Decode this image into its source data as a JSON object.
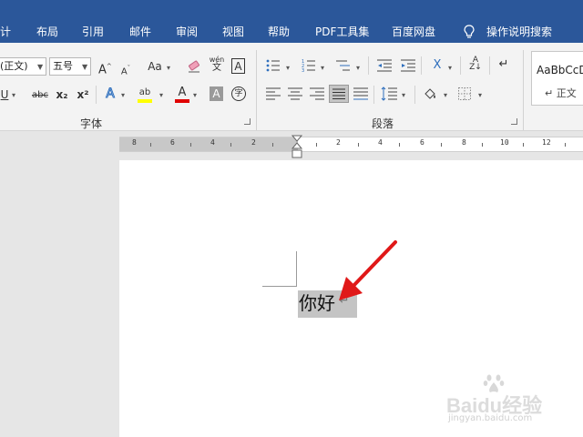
{
  "tabs": [
    "计",
    "布局",
    "引用",
    "邮件",
    "审阅",
    "视图",
    "帮助",
    "PDF工具集",
    "百度网盘",
    "操作说明搜索"
  ],
  "font": {
    "name_value": "(正文)",
    "size_value": "五号",
    "grow_label": "A",
    "shrink_label": "A",
    "case_label": "Aa",
    "phonetic_label": "wén",
    "phonetic_sub": "文",
    "border_char_label": "A",
    "underline_label": "U",
    "strike_label": "abc",
    "sub_label": "x₂",
    "sup_label": "x²",
    "effects_label": "A",
    "highlight_label": "ab",
    "color_label": "A",
    "shading_label": "A",
    "enclose_label": "字",
    "group_label": "字体"
  },
  "paragraph": {
    "group_label": "段落"
  },
  "styles": {
    "sample": "AaBbCcD",
    "name": "正文"
  },
  "ruler": {
    "left_numbers": [
      "8",
      "6",
      "4",
      "2"
    ],
    "right_numbers": [
      "2",
      "4",
      "6",
      "8",
      "10",
      "12"
    ]
  },
  "document": {
    "text": "你好",
    "paragraph_mark": "↵"
  },
  "watermark": {
    "brand": "Baidu经验",
    "url": "jingyan.baidu.com"
  },
  "colors": {
    "tab_bar": "#2b579a",
    "highlight": "#ffff00",
    "font_color": "#e00000",
    "arrow": "#e01818"
  }
}
